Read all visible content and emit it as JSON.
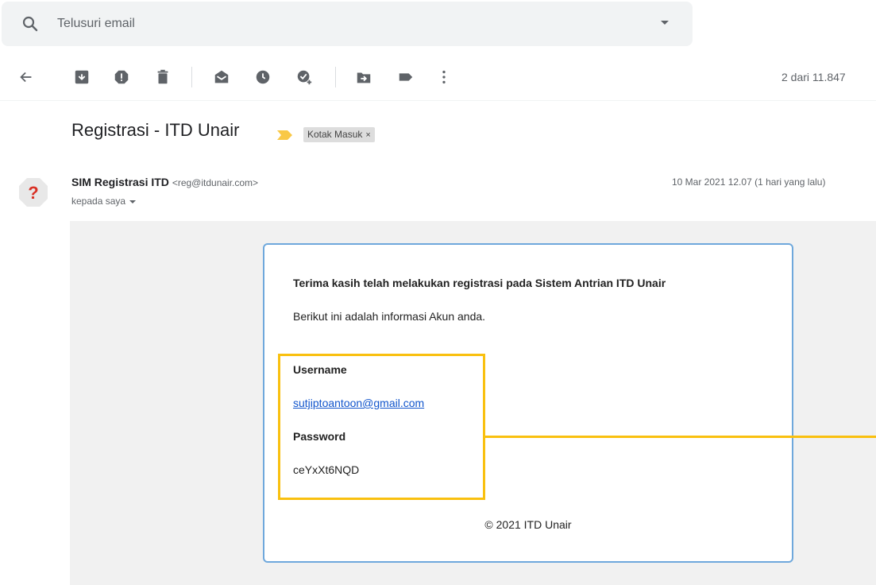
{
  "search": {
    "placeholder": "Telusuri email"
  },
  "toolbar": {
    "counter": "2 dari 11.847"
  },
  "message": {
    "subject": "Registrasi - ITD Unair",
    "label": "Kotak Masuk",
    "label_close": "×",
    "sender_name": "SIM Registrasi ITD",
    "sender_email": "<reg@itdunair.com>",
    "recipient": "kepada saya",
    "date": "10 Mar 2021 12.07 (1 hari yang lalu)"
  },
  "body": {
    "thanks": "Terima kasih telah melakukan registrasi pada Sistem Antrian ITD Unair",
    "info": "Berikut ini adalah informasi Akun anda.",
    "username_label": "Username",
    "username_value": "sutjiptoantoon@gmail.com",
    "password_label": "Password",
    "password_value": "ceYxXt6NQD",
    "footer": "© 2021 ITD Unair"
  },
  "colors": {
    "highlight": "#f9c00f",
    "card_border": "#6fa8dc",
    "link": "#1155cc",
    "importance_marker": "#f9c846",
    "avatar_mark": "#d93025"
  }
}
